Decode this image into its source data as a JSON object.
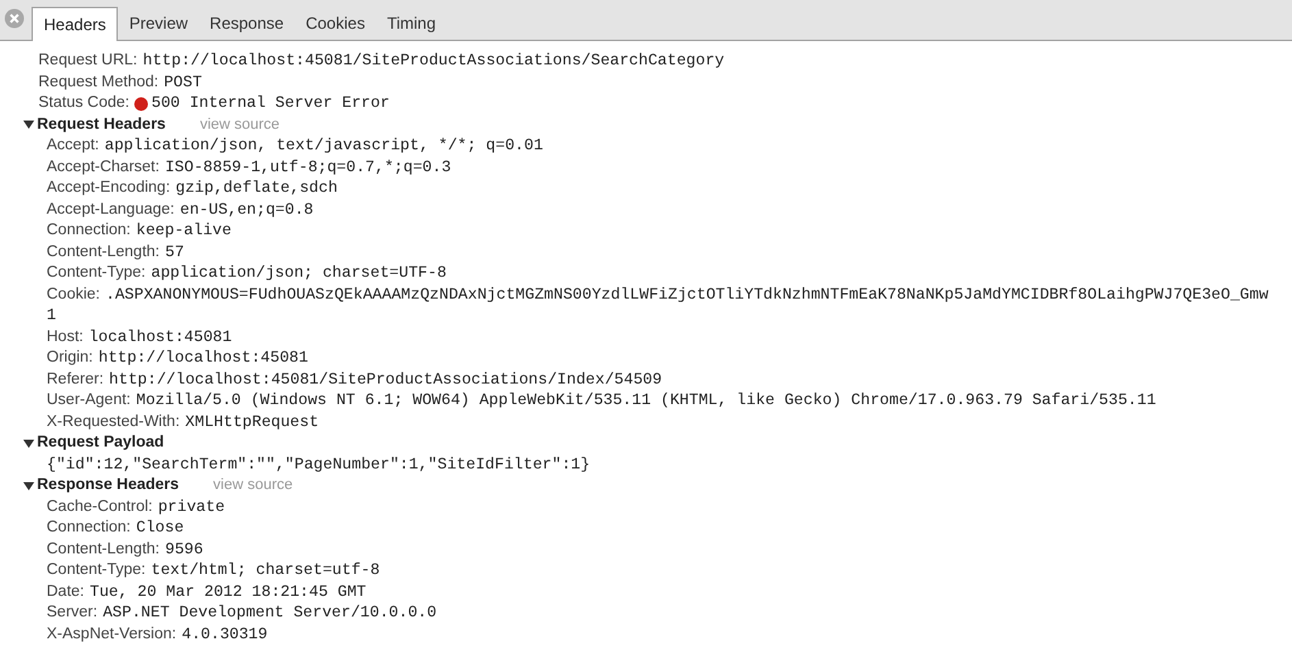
{
  "tabs": [
    {
      "label": "Headers",
      "selected": true
    },
    {
      "label": "Preview",
      "selected": false
    },
    {
      "label": "Response",
      "selected": false
    },
    {
      "label": "Cookies",
      "selected": false
    },
    {
      "label": "Timing",
      "selected": false
    }
  ],
  "general": [
    {
      "name": "Request URL:",
      "value": "http://localhost:45081/SiteProductAssociations/SearchCategory"
    },
    {
      "name": "Request Method:",
      "value": "POST"
    },
    {
      "name": "Status Code:",
      "value": "500 Internal Server Error",
      "color": "#d0201a"
    }
  ],
  "sections": [
    {
      "kind": "headers",
      "title": "Request Headers",
      "expanded": true,
      "link": "view source",
      "headers": [
        {
          "name": "Accept:",
          "value": "application/json, text/javascript, */*; q=0.01"
        },
        {
          "name": "Accept-Charset:",
          "value": "ISO-8859-1,utf-8;q=0.7,*;q=0.3"
        },
        {
          "name": "Accept-Encoding:",
          "value": "gzip,deflate,sdch"
        },
        {
          "name": "Accept-Language:",
          "value": "en-US,en;q=0.8"
        },
        {
          "name": "Connection:",
          "value": "keep-alive"
        },
        {
          "name": "Content-Length:",
          "value": "57"
        },
        {
          "name": "Content-Type:",
          "value": "application/json; charset=UTF-8"
        },
        {
          "name": "Cookie:",
          "value": ".ASPXANONYMOUS=FUdhOUASzQEkAAAAMzQzNDAxNjctMGZmNS00YzdlLWFiZjctOTliYTdkNzhmNTFmEaK78NaNKp5JaMdYMCIDBRf8OLaihgPWJ7QE3eO_Gmw",
          "continuation": "1"
        },
        {
          "name": "Host:",
          "value": "localhost:45081"
        },
        {
          "name": "Origin:",
          "value": "http://localhost:45081"
        },
        {
          "name": "Referer:",
          "value": "http://localhost:45081/SiteProductAssociations/Index/54509"
        },
        {
          "name": "User-Agent:",
          "value": "Mozilla/5.0 (Windows NT 6.1; WOW64) AppleWebKit/535.11 (KHTML, like Gecko) Chrome/17.0.963.79 Safari/535.11"
        },
        {
          "name": "X-Requested-With:",
          "value": "XMLHttpRequest"
        }
      ]
    },
    {
      "kind": "payload",
      "title": "Request Payload",
      "expanded": true,
      "payload": "{\"id\":12,\"SearchTerm\":\"\",\"PageNumber\":1,\"SiteIdFilter\":1}"
    },
    {
      "kind": "headers",
      "title": "Response Headers",
      "expanded": true,
      "link": "view source",
      "headers": [
        {
          "name": "Cache-Control:",
          "value": "private"
        },
        {
          "name": "Connection:",
          "value": "Close"
        },
        {
          "name": "Content-Length:",
          "value": "9596"
        },
        {
          "name": "Content-Type:",
          "value": "text/html; charset=utf-8"
        },
        {
          "name": "Date:",
          "value": "Tue, 20 Mar 2012 18:21:45 GMT"
        },
        {
          "name": "Server:",
          "value": "ASP.NET Development Server/10.0.0.0"
        },
        {
          "name": "X-AspNet-Version:",
          "value": "4.0.30319"
        }
      ]
    }
  ]
}
